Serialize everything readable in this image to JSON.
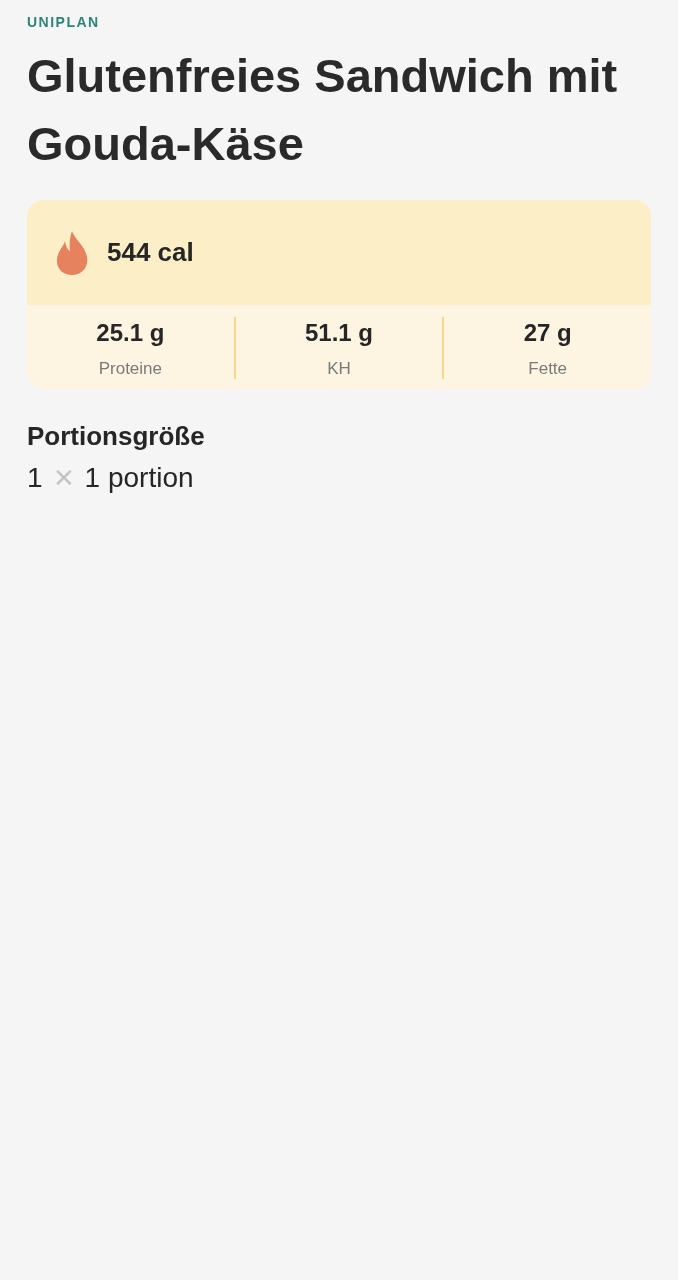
{
  "brand": "UNIPLAN",
  "title": "Glutenfreies Sandwich mit Gouda-Käse",
  "calories": "544 cal",
  "macros": [
    {
      "value": "25.1 g",
      "label": "Proteine"
    },
    {
      "value": "51.1 g",
      "label": "KH"
    },
    {
      "value": "27 g",
      "label": "Fette"
    }
  ],
  "portion": {
    "heading": "Portionsgröße",
    "quantity": "1",
    "times": "✕",
    "unit": "1 portion"
  }
}
